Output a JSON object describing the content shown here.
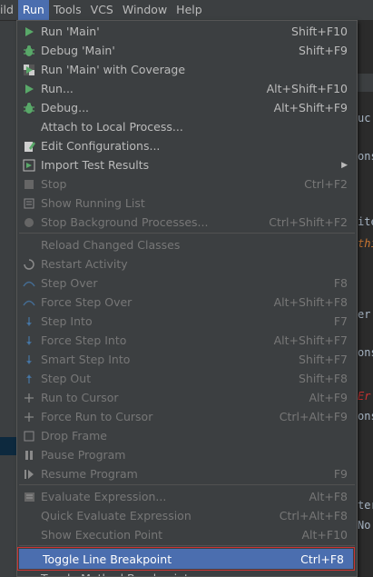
{
  "menubar": {
    "items": [
      {
        "label": "ild"
      },
      {
        "label": "Run",
        "active": true
      },
      {
        "label": "Tools"
      },
      {
        "label": "VCS"
      },
      {
        "label": "Window"
      },
      {
        "label": "Help"
      }
    ]
  },
  "editor_fragments": [
    "uc",
    "ons",
    "ite",
    "thi",
    "er",
    "ons",
    "Er",
    "ons",
    "ter",
    "No"
  ],
  "menu": {
    "items": [
      {
        "label": "Run 'Main'",
        "shortcut": "Shift+F10",
        "icon": "run-icon",
        "disabled": false
      },
      {
        "label": "Debug 'Main'",
        "shortcut": "Shift+F9",
        "icon": "debug-icon",
        "disabled": false
      },
      {
        "label": "Run 'Main' with Coverage",
        "shortcut": "",
        "icon": "coverage-icon",
        "disabled": false
      },
      {
        "label": "Run...",
        "shortcut": "Alt+Shift+F10",
        "icon": "run-icon",
        "disabled": false
      },
      {
        "label": "Debug...",
        "shortcut": "Alt+Shift+F9",
        "icon": "debug-icon",
        "disabled": false
      },
      {
        "label": "Attach to Local Process...",
        "shortcut": "",
        "icon": "",
        "disabled": false
      },
      {
        "label": "Edit Configurations...",
        "shortcut": "",
        "icon": "edit-config-icon",
        "disabled": false
      },
      {
        "label": "Import Test Results",
        "shortcut": "",
        "icon": "import-icon",
        "disabled": false,
        "submenu": true
      },
      {
        "label": "Stop",
        "shortcut": "Ctrl+F2",
        "icon": "stop-icon",
        "disabled": true
      },
      {
        "label": "Show Running List",
        "shortcut": "",
        "icon": "list-icon",
        "disabled": true
      },
      {
        "label": "Stop Background Processes...",
        "shortcut": "Ctrl+Shift+F2",
        "icon": "stop-bg-icon",
        "disabled": true
      },
      {
        "separator": true
      },
      {
        "label": "Reload Changed Classes",
        "shortcut": "",
        "icon": "",
        "disabled": true
      },
      {
        "label": "Restart Activity",
        "shortcut": "",
        "icon": "restart-icon",
        "disabled": true
      },
      {
        "label": "Step Over",
        "shortcut": "F8",
        "icon": "step-over-icon",
        "disabled": true
      },
      {
        "label": "Force Step Over",
        "shortcut": "Alt+Shift+F8",
        "icon": "force-step-over-icon",
        "disabled": true
      },
      {
        "label": "Step Into",
        "shortcut": "F7",
        "icon": "step-into-icon",
        "disabled": true
      },
      {
        "label": "Force Step Into",
        "shortcut": "Alt+Shift+F7",
        "icon": "force-step-into-icon",
        "disabled": true
      },
      {
        "label": "Smart Step Into",
        "shortcut": "Shift+F7",
        "icon": "smart-step-into-icon",
        "disabled": true
      },
      {
        "label": "Step Out",
        "shortcut": "Shift+F8",
        "icon": "step-out-icon",
        "disabled": true
      },
      {
        "label": "Run to Cursor",
        "shortcut": "Alt+F9",
        "icon": "run-to-cursor-icon",
        "disabled": true
      },
      {
        "label": "Force Run to Cursor",
        "shortcut": "Ctrl+Alt+F9",
        "icon": "force-run-to-cursor-icon",
        "disabled": true
      },
      {
        "label": "Drop Frame",
        "shortcut": "",
        "icon": "drop-frame-icon",
        "disabled": true
      },
      {
        "label": "Pause Program",
        "shortcut": "",
        "icon": "pause-icon",
        "disabled": true
      },
      {
        "label": "Resume Program",
        "shortcut": "F9",
        "icon": "resume-icon",
        "disabled": true
      },
      {
        "separator": true
      },
      {
        "label": "Evaluate Expression...",
        "shortcut": "Alt+F8",
        "icon": "evaluate-icon",
        "disabled": true
      },
      {
        "label": "Quick Evaluate Expression",
        "shortcut": "Ctrl+Alt+F8",
        "icon": "",
        "disabled": true
      },
      {
        "label": "Show Execution Point",
        "shortcut": "Alt+F10",
        "icon": "",
        "disabled": true
      },
      {
        "separator": true
      },
      {
        "label": "Toggle Line Breakpoint",
        "shortcut": "Ctrl+F8",
        "icon": "",
        "disabled": false,
        "highlight": true
      },
      {
        "label": "Toggle Method Breakpoint",
        "shortcut": "",
        "icon": "",
        "disabled": false
      }
    ]
  },
  "colors": {
    "menu_bg": "#3c3f41",
    "selection": "#4b6eaf",
    "run_green": "#59a869",
    "annotation_red": "#cc3333"
  }
}
